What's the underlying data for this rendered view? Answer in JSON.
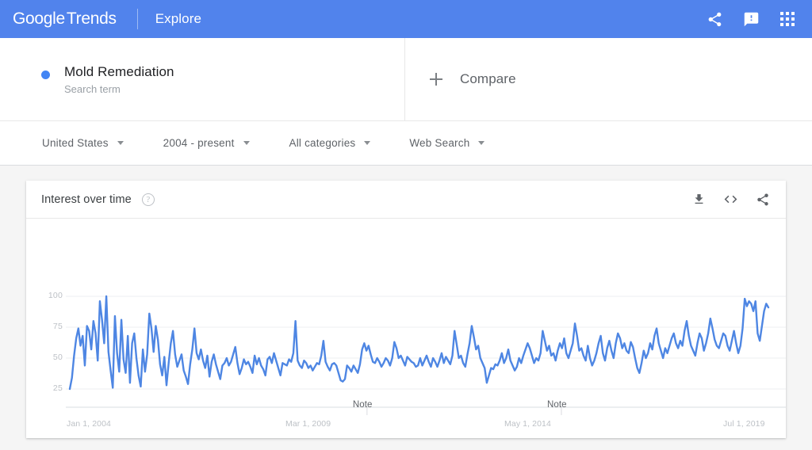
{
  "header": {
    "logo_google": "Google",
    "logo_trends": "Trends",
    "explore_label": "Explore",
    "share_icon": "share-icon",
    "feedback_icon": "feedback-icon",
    "apps_icon": "apps-grid-icon",
    "background_color": "#5183ec"
  },
  "query": {
    "term": "Mold Remediation",
    "type_label": "Search term",
    "dot_color": "#4285f4",
    "compare_label": "Compare",
    "compare_icon": "plus-icon"
  },
  "filters": [
    {
      "label": "United States",
      "name": "region"
    },
    {
      "label": "2004 - present",
      "name": "time-range"
    },
    {
      "label": "All categories",
      "name": "category"
    },
    {
      "label": "Web Search",
      "name": "search-type"
    }
  ],
  "card": {
    "title": "Interest over time",
    "help_icon": "help-circle-icon",
    "download_icon": "download-icon",
    "embed_icon": "embed-code-icon",
    "share_icon": "share-icon"
  },
  "chart_data": {
    "type": "line",
    "title": "Interest over time",
    "xlabel": "",
    "ylabel": "",
    "ylim": [
      0,
      108
    ],
    "yticks": [
      25,
      50,
      75,
      100
    ],
    "ytick_labels": [
      "25",
      "50",
      "75",
      "100"
    ],
    "grid": true,
    "legend": false,
    "line_color": "#4e86e3",
    "line_width": 2.4,
    "xtick_labels": [
      "Jan 1, 2004",
      "Mar 1, 2009",
      "May 1, 2014",
      "Jul 1, 2019"
    ],
    "xtick_positions": [
      0,
      0.3133,
      0.6266,
      0.9399
    ],
    "annotations": [
      {
        "label": "Note",
        "position": 0.4255
      },
      {
        "label": "Note",
        "position": 0.7037
      }
    ],
    "series": [
      {
        "name": "Mold Remediation",
        "values": [
          25,
          34,
          52,
          66,
          74,
          60,
          68,
          44,
          76,
          72,
          57,
          80,
          70,
          48,
          96,
          81,
          62,
          100,
          55,
          40,
          26,
          84,
          54,
          39,
          81,
          49,
          38,
          68,
          30,
          62,
          70,
          50,
          36,
          27,
          57,
          39,
          53,
          86,
          74,
          55,
          76,
          65,
          45,
          36,
          51,
          28,
          46,
          62,
          72,
          53,
          43,
          48,
          53,
          40,
          35,
          29,
          45,
          57,
          74,
          54,
          49,
          57,
          48,
          42,
          52,
          35,
          47,
          53,
          45,
          39,
          33,
          44,
          46,
          50,
          44,
          47,
          53,
          59,
          46,
          37,
          42,
          49,
          45,
          47,
          43,
          38,
          52,
          45,
          50,
          44,
          41,
          36,
          49,
          51,
          46,
          54,
          48,
          42,
          36,
          46,
          45,
          44,
          49,
          47,
          54,
          80,
          48,
          44,
          42,
          48,
          46,
          42,
          44,
          40,
          43,
          46,
          45,
          52,
          64,
          47,
          43,
          40,
          45,
          46,
          44,
          38,
          32,
          31,
          33,
          44,
          42,
          39,
          44,
          41,
          38,
          45,
          57,
          62,
          56,
          60,
          53,
          47,
          46,
          50,
          47,
          43,
          46,
          50,
          48,
          44,
          50,
          63,
          58,
          50,
          52,
          48,
          44,
          51,
          49,
          47,
          46,
          43,
          44,
          50,
          44,
          48,
          52,
          47,
          43,
          50,
          47,
          43,
          48,
          54,
          46,
          51,
          48,
          45,
          52,
          72,
          61,
          50,
          52,
          46,
          43,
          53,
          62,
          76,
          67,
          57,
          60,
          50,
          46,
          42,
          30,
          36,
          42,
          41,
          45,
          44,
          48,
          54,
          46,
          50,
          57,
          48,
          44,
          40,
          43,
          50,
          46,
          52,
          57,
          62,
          58,
          52,
          46,
          50,
          48,
          54,
          72,
          64,
          56,
          60,
          52,
          54,
          48,
          56,
          62,
          58,
          66,
          54,
          50,
          56,
          62,
          78,
          68,
          56,
          58,
          52,
          48,
          60,
          50,
          44,
          48,
          54,
          62,
          68,
          54,
          48,
          58,
          64,
          56,
          50,
          62,
          70,
          66,
          58,
          62,
          56,
          54,
          63,
          59,
          50,
          42,
          38,
          46,
          56,
          50,
          54,
          62,
          57,
          68,
          74,
          62,
          56,
          50,
          58,
          54,
          60,
          66,
          70,
          62,
          58,
          64,
          60,
          72,
          80,
          68,
          60,
          56,
          52,
          62,
          70,
          66,
          56,
          62,
          70,
          82,
          74,
          65,
          60,
          58,
          64,
          70,
          68,
          60,
          56,
          64,
          72,
          62,
          54,
          60,
          74,
          98,
          92,
          96,
          94,
          88,
          96,
          70,
          64,
          76,
          88,
          94,
          91
        ]
      }
    ]
  }
}
